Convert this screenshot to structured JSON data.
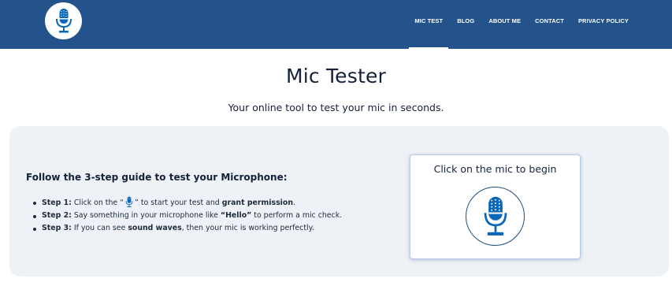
{
  "header": {
    "logo_icon": "microphone-icon",
    "nav": [
      "MIC TEST",
      "BLOG",
      "ABOUT ME",
      "CONTACT",
      "PRIVACY POLICY"
    ],
    "active_nav": "MIC TEST"
  },
  "main": {
    "title": "Mic Tester",
    "subtitle": "Your online tool to test your mic in seconds."
  },
  "guide": {
    "heading": "Follow the 3-step guide to test your Microphone:",
    "step1": {
      "label": "Step 1:",
      "pre": "Click on the “",
      "icon": "microphone-icon",
      "post": "” to start your test and ",
      "bold": "grant permission",
      "end": "."
    },
    "step2": {
      "label": "Step 2:",
      "pre": "Say something in your microphone like ",
      "bold": "“Hello”",
      "end": " to perform a mic check."
    },
    "step3": {
      "label": "Step 3:",
      "pre": "If you can see ",
      "bold": "sound waves",
      "end": ", then your mic is working perfectly."
    }
  },
  "card": {
    "title": "Click on the mic to begin",
    "button_icon": "microphone-icon"
  },
  "colors": {
    "header_bg": "#23538a",
    "mic_blue": "#0a67b8",
    "panel_bg": "#eef1f5"
  }
}
